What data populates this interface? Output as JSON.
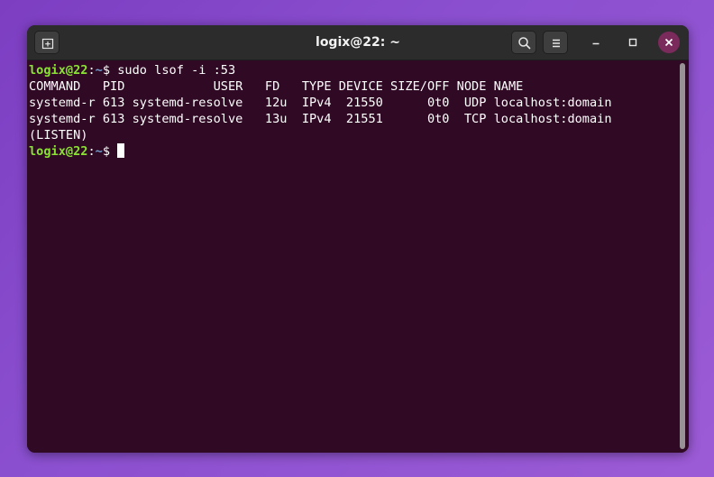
{
  "window": {
    "title": "logix@22: ~"
  },
  "headerbar": {
    "new_tab_icon": "new-tab-icon",
    "search_icon": "search-icon",
    "menu_icon": "hamburger-menu-icon",
    "minimize_icon": "minimize-icon",
    "maximize_icon": "maximize-icon",
    "close_icon": "close-icon"
  },
  "terminal": {
    "prompt1": {
      "user": "logix@22",
      "sep": ":",
      "path": "~",
      "symbol": "$",
      "command": " sudo lsof -i :53"
    },
    "header_line": "COMMAND   PID            USER   FD   TYPE DEVICE SIZE/OFF NODE NAME",
    "rows": [
      "systemd-r 613 systemd-resolve   12u  IPv4  21550      0t0  UDP localhost:domain",
      "systemd-r 613 systemd-resolve   13u  IPv4  21551      0t0  TCP localhost:domain"
    ],
    "wrap_line": "(LISTEN)",
    "prompt2": {
      "user": "logix@22",
      "sep": ":",
      "path": "~",
      "symbol": "$ "
    }
  },
  "colors": {
    "desktop_bg": "#8a4fcf",
    "terminal_bg": "#300a24",
    "headerbar_bg": "#2c2c2c",
    "prompt_user": "#8ae234",
    "prompt_path": "#729fcf",
    "close_button": "#7a2a5b"
  }
}
